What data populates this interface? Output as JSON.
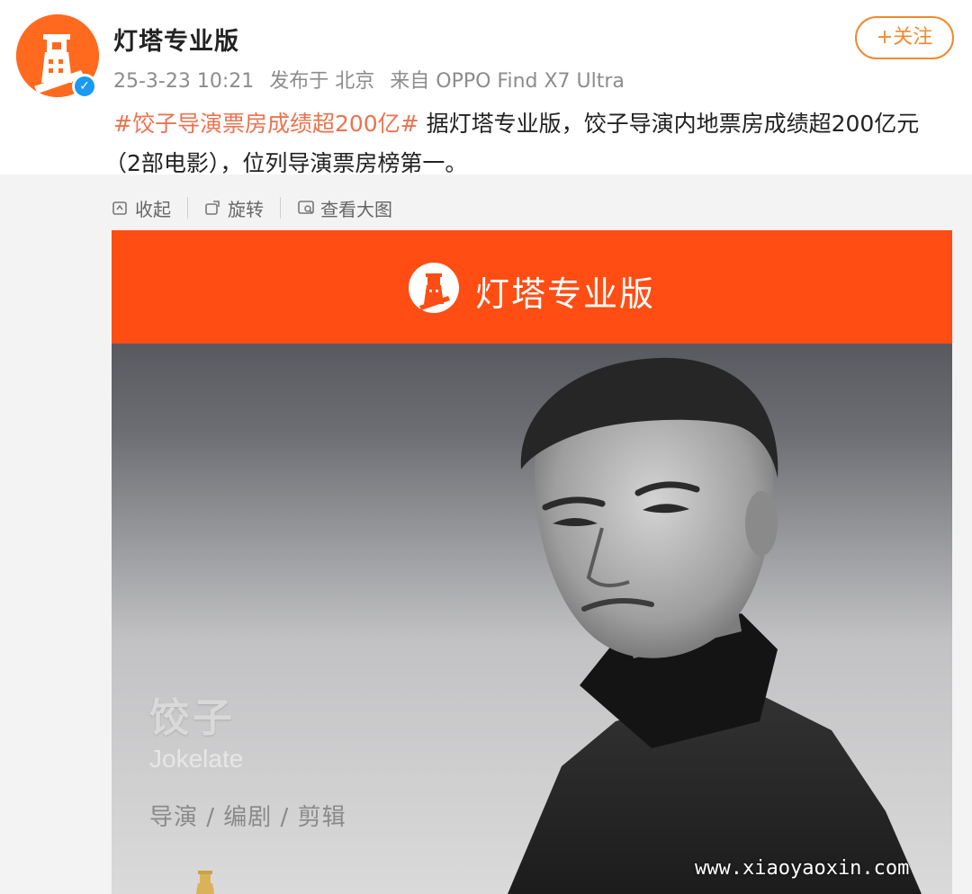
{
  "post": {
    "author": "灯塔专业版",
    "date": "25-3-23 10:21",
    "location": "发布于 北京",
    "source": "来自 OPPO Find X7 Ultra",
    "follow_label": "+关注",
    "hashtag": "#饺子导演票房成绩超200亿#",
    "text_1": " 据灯塔专业版，饺子导演内地票房成绩超200亿元",
    "text_2": "（2部电影），位列导演票房榜第一。"
  },
  "toolbar": {
    "collapse_label": "收起",
    "rotate_label": "旋转",
    "view_large_label": "查看大图"
  },
  "image": {
    "banner_title": "灯塔专业版",
    "name_cn": "饺子",
    "name_en": "Jokelate",
    "roles": "导演 / 编剧 / 剪辑"
  },
  "watermark": "www.xiaoyaoxin.com",
  "colors": {
    "brand_orange": "#ff4d14",
    "hashtag": "#eb7350",
    "follow": "#f08a2c",
    "verified": "#1a9af0"
  }
}
